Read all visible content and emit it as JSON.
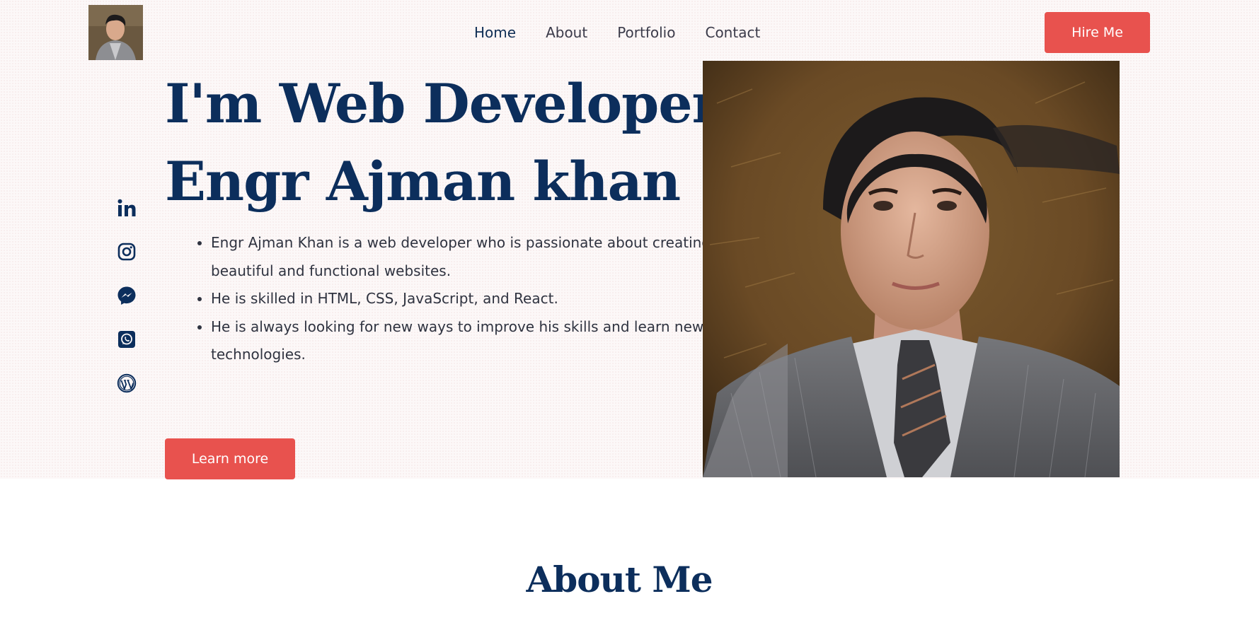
{
  "header": {
    "nav": [
      {
        "label": "Home"
      },
      {
        "label": "About"
      },
      {
        "label": "Portfolio"
      },
      {
        "label": "Contact"
      }
    ],
    "hire_label": "Hire Me"
  },
  "hero": {
    "headline_line1": "I'm Web Developer",
    "headline_line2": "Engr Ajman khan",
    "bullets": [
      "Engr Ajman Khan is a web developer who is passionate about creating beautiful and functional websites.",
      "He is skilled in HTML, CSS, JavaScript, and React.",
      "He is always looking for new ways to improve his skills and learn new technologies."
    ],
    "learn_label": "Learn more"
  },
  "social": {
    "icons": [
      "linkedin-icon",
      "instagram-icon",
      "messenger-icon",
      "whatsapp-icon",
      "wordpress-icon"
    ]
  },
  "about": {
    "title": "About Me"
  },
  "colors": {
    "primary": "#0c2e5c",
    "accent": "#e8524e",
    "hero_bg": "#fcf8f8"
  }
}
